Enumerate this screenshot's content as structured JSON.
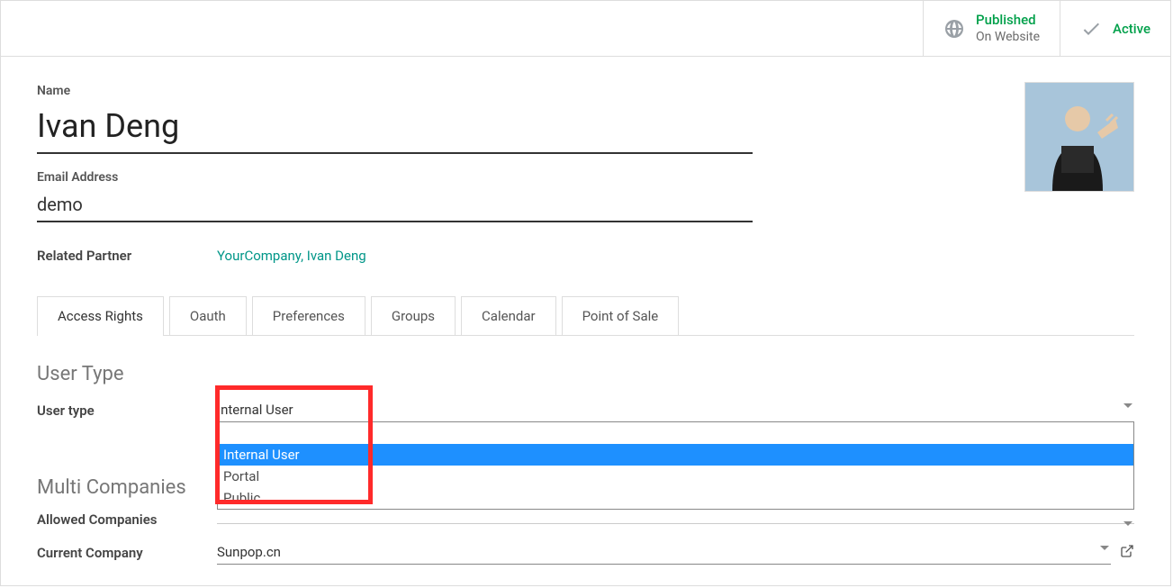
{
  "status": {
    "published_main": "Published",
    "published_sub": "On Website",
    "active_label": "Active"
  },
  "form": {
    "name_label": "Name",
    "name_value": "Ivan Deng",
    "email_label": "Email Address",
    "email_value": "demo",
    "related_label": "Related Partner",
    "related_value": "YourCompany, Ivan Deng"
  },
  "tabs": {
    "access_rights": "Access Rights",
    "oauth": "Oauth",
    "preferences": "Preferences",
    "groups": "Groups",
    "calendar": "Calendar",
    "pos": "Point of Sale"
  },
  "user_type": {
    "section_title": "User Type",
    "label": "User type",
    "selected": "Internal User",
    "options": [
      "Internal User",
      "Portal",
      "Public"
    ]
  },
  "multi_companies": {
    "section_title": "Multi Companies",
    "allowed_label": "Allowed Companies",
    "current_label": "Current Company",
    "current_value": "Sunpop.cn"
  }
}
